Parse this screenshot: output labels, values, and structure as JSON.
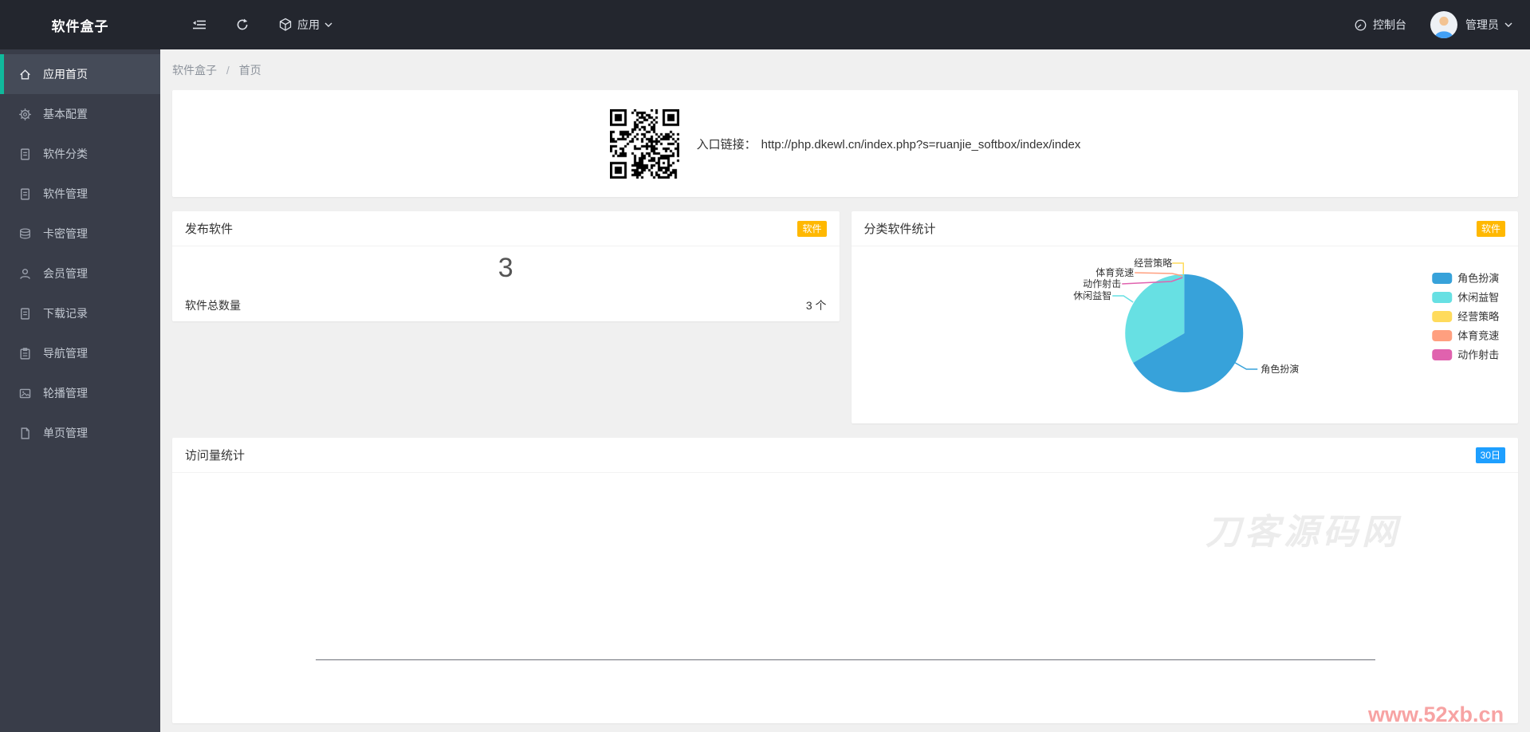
{
  "topbar": {
    "logo": "软件盒子",
    "app_menu": "应用",
    "console_label": "控制台",
    "user_label": "管理员"
  },
  "breadcrumb": {
    "root": "软件盒子",
    "separator": "/",
    "current": "首页"
  },
  "sidebar": {
    "items": [
      {
        "label": "应用首页",
        "icon": "home-icon",
        "active": true
      },
      {
        "label": "基本配置",
        "icon": "gear-icon"
      },
      {
        "label": "软件分类",
        "icon": "doc-icon"
      },
      {
        "label": "软件管理",
        "icon": "doc-icon"
      },
      {
        "label": "卡密管理",
        "icon": "layers-icon"
      },
      {
        "label": "会员管理",
        "icon": "user-icon"
      },
      {
        "label": "下载记录",
        "icon": "doc-icon"
      },
      {
        "label": "导航管理",
        "icon": "clipboard-icon"
      },
      {
        "label": "轮播管理",
        "icon": "image-icon"
      },
      {
        "label": "单页管理",
        "icon": "file-icon"
      }
    ]
  },
  "entry": {
    "label": "入口链接：",
    "url": "http://php.dkewl.cn/index.php?s=ruanjie_softbox/index/index"
  },
  "cards": {
    "publish": {
      "title": "发布软件",
      "badge": "软件",
      "total": "3",
      "row_label": "软件总数量",
      "row_value": "3 个"
    },
    "category": {
      "title": "分类软件统计",
      "badge": "软件"
    },
    "visits": {
      "title": "访问量统计",
      "badge": "30日"
    }
  },
  "chart_data": [
    {
      "type": "pie",
      "title": "分类软件统计",
      "labels": [
        "角色扮演",
        "休闲益智",
        "经营策略",
        "体育竞速",
        "动作射击"
      ],
      "values": [
        2,
        1,
        0,
        0,
        0
      ],
      "colors": [
        "#37A2DA",
        "#67E0E3",
        "#FFDB5C",
        "#FF9F7F",
        "#E062AE"
      ],
      "legend_position": "right",
      "unit": "个"
    },
    {
      "type": "line",
      "title": "访问量统计",
      "period": "30日",
      "x": [],
      "series": [],
      "has_data": false
    }
  ],
  "watermarks": {
    "chart": "刀客源码网",
    "site": "www.52xb.cn"
  },
  "colors": {
    "badge_orange": "#FFB800",
    "badge_blue": "#1E9FFF",
    "accent_teal": "#10B99C",
    "topbar_bg": "#23262E",
    "sidebar_bg": "#393D49",
    "axis": "#6E7079"
  }
}
